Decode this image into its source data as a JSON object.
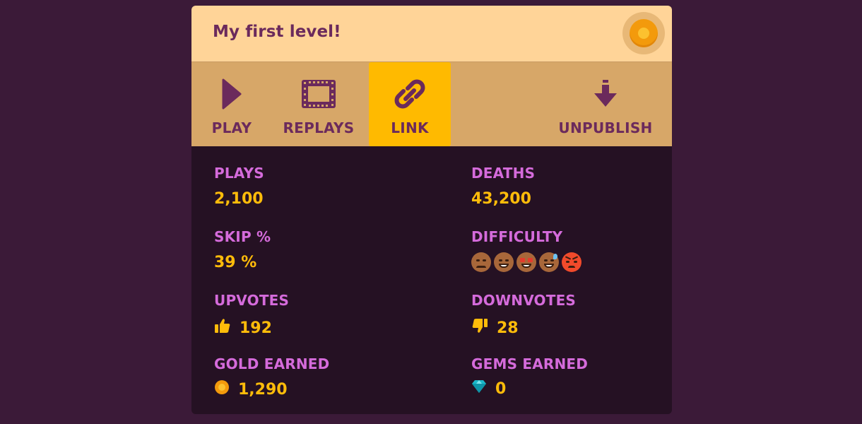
{
  "header": {
    "title": "My first level!",
    "coin_button_icon": "gold-coin-icon"
  },
  "toolbar": {
    "items": [
      {
        "label": "PLAY",
        "icon": "play-icon",
        "active": false
      },
      {
        "label": "REPLAYS",
        "icon": "film-strip-icon",
        "active": false
      },
      {
        "label": "LINK",
        "icon": "link-icon",
        "active": true
      },
      {
        "label": "UNPUBLISH",
        "icon": "download-arrow-icon",
        "active": false
      }
    ]
  },
  "stats": {
    "plays": {
      "label": "PLAYS",
      "value": "2,100"
    },
    "deaths": {
      "label": "DEATHS",
      "value": "43,200"
    },
    "skip": {
      "label": "SKIP %",
      "value": "39 %"
    },
    "difficulty": {
      "label": "DIFFICULTY",
      "icons": [
        "sad-face",
        "grin-face",
        "starstruck-face",
        "sweat-grin-face",
        "angry-face"
      ]
    },
    "upvotes": {
      "label": "UPVOTES",
      "value": "192",
      "icon": "thumbs-up-icon"
    },
    "downvotes": {
      "label": "DOWNVOTES",
      "value": "28",
      "icon": "thumbs-down-icon"
    },
    "gold": {
      "label": "GOLD EARNED",
      "value": "1,290",
      "icon": "gold-coin-icon"
    },
    "gems": {
      "label": "GEMS EARNED",
      "value": "0",
      "icon": "gem-icon"
    }
  },
  "colors": {
    "background": "#3b1a38",
    "header": "#ffd498",
    "toolbar": "#d7a768",
    "active_tab": "#ffba00",
    "stat_label": "#d56bdb",
    "stat_value": "#ffbc0a",
    "panel": "#251123"
  }
}
